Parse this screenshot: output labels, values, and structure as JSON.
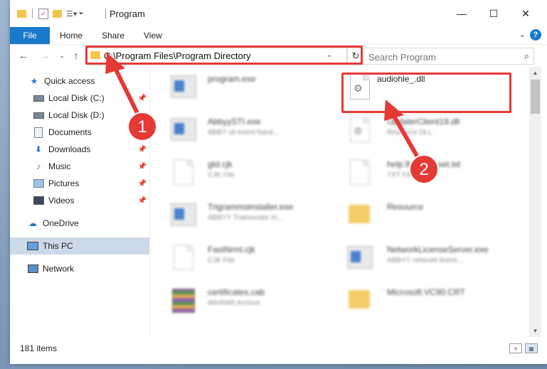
{
  "window": {
    "title": "Program",
    "minimize": "—",
    "maximize": "☐",
    "close": "✕"
  },
  "ribbon": {
    "tabs": [
      "File",
      "Home",
      "Share",
      "View"
    ],
    "help": "?"
  },
  "address": {
    "path": "C:\\Program Files\\Program Directory",
    "refresh": "↻"
  },
  "search": {
    "placeholder": "Search Program"
  },
  "sidebar": {
    "items": [
      {
        "label": "Quick access",
        "icon": "star-icon",
        "pinned": false
      },
      {
        "label": "Local Disk (C:)",
        "icon": "drive-icon",
        "pinned": true
      },
      {
        "label": "Local Disk (D:)",
        "icon": "drive-icon",
        "pinned": false
      },
      {
        "label": "Documents",
        "icon": "documents-icon",
        "pinned": true
      },
      {
        "label": "Downloads",
        "icon": "downloads-icon",
        "pinned": true
      },
      {
        "label": "Music",
        "icon": "music-icon",
        "pinned": true
      },
      {
        "label": "Pictures",
        "icon": "pictures-icon",
        "pinned": true
      },
      {
        "label": "Videos",
        "icon": "videos-icon",
        "pinned": true
      },
      {
        "label": "OneDrive",
        "icon": "cloud-icon",
        "pinned": false
      },
      {
        "label": "This PC",
        "icon": "computer-icon",
        "pinned": false,
        "selected": true
      },
      {
        "label": "Network",
        "icon": "network-icon",
        "pinned": false
      }
    ]
  },
  "files": [
    {
      "name": "program.exe",
      "desc": "",
      "kind": "exe",
      "blurred": true
    },
    {
      "name": "audiohle_.dll",
      "desc": "",
      "kind": "dll",
      "blurred": false
    },
    {
      "name": "AbbyySTI.exe",
      "desc": "ABBY sti event hand...",
      "kind": "exe",
      "blurred": true
    },
    {
      "name": "UpdaterClient19.dll",
      "desc": "Resource DLL",
      "kind": "dll",
      "blurred": true
    },
    {
      "name": "gtd.cjk",
      "desc": "CJK File",
      "kind": "doc",
      "blurred": true
    },
    {
      "name": "help.first.typeset.txt",
      "desc": "TXT File",
      "kind": "doc",
      "blurred": true
    },
    {
      "name": "Trigrammsinstaller.exe",
      "desc": "ABBYY Trainrecder In...",
      "kind": "exe",
      "blurred": true
    },
    {
      "name": "Resource",
      "desc": "",
      "kind": "folder",
      "blurred": true
    },
    {
      "name": "FastNrml.cjk",
      "desc": "CJK File",
      "kind": "doc",
      "blurred": true
    },
    {
      "name": "NetworkLicenseServer.exe",
      "desc": "ABBYY network licens...",
      "kind": "exe",
      "blurred": true
    },
    {
      "name": "certificates.cab",
      "desc": "WinRAR Archive",
      "kind": "cab",
      "blurred": true
    },
    {
      "name": "Microsoft.VC90.CRT",
      "desc": "",
      "kind": "folder",
      "blurred": true
    }
  ],
  "annotations": {
    "step1": "1",
    "step2": "2",
    "accent": "#e53935"
  },
  "status": {
    "count": "181 items"
  }
}
